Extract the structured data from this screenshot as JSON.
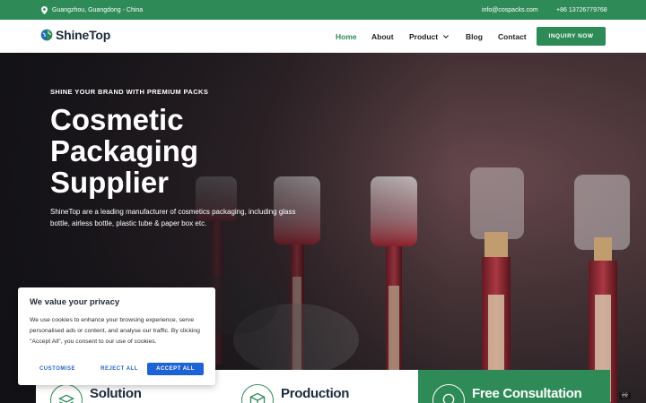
{
  "topbar": {
    "location": "Guangzhou, Guangdong - China",
    "email": "info@cospacks.com",
    "phone": "+86 13726779768",
    "icon": "map-pin-icon"
  },
  "brand": {
    "name": "ShineTop",
    "colors": {
      "primary": "#2e8b57",
      "dark": "#1c2a3a"
    }
  },
  "nav": {
    "items": [
      {
        "label": "Home",
        "active": true
      },
      {
        "label": "About"
      },
      {
        "label": "Product",
        "has_dropdown": true
      },
      {
        "label": "Blog"
      },
      {
        "label": "Contact"
      }
    ],
    "cta": "INQUIRY NOW"
  },
  "hero": {
    "tagline": "SHINE YOUR BRAND WITH PREMIUM PACKS",
    "headline": "Cosmetic Packaging Supplier",
    "description": "ShineTop are a leading manufacturer of cosmetics packaging, including glass bottle, airless bottle, plastic tube & paper box etc."
  },
  "cookie": {
    "title": "We value your privacy",
    "text": "We use cookies to enhance your browsing experience, serve personalised ads or content, and analyse our traffic. By clicking \"Accept All\", you consent to our use of cookies.",
    "buttons": {
      "customise": "CUSTOMISE",
      "reject": "REJECT ALL",
      "accept": "ACCEPT ALL"
    }
  },
  "cards": [
    {
      "title": "Solution",
      "icon": "layers-icon"
    },
    {
      "title": "Production",
      "icon": "box-icon"
    },
    {
      "title": "Free Consultation",
      "icon": "chat-icon"
    }
  ],
  "corner_tag": "ਏਓ"
}
